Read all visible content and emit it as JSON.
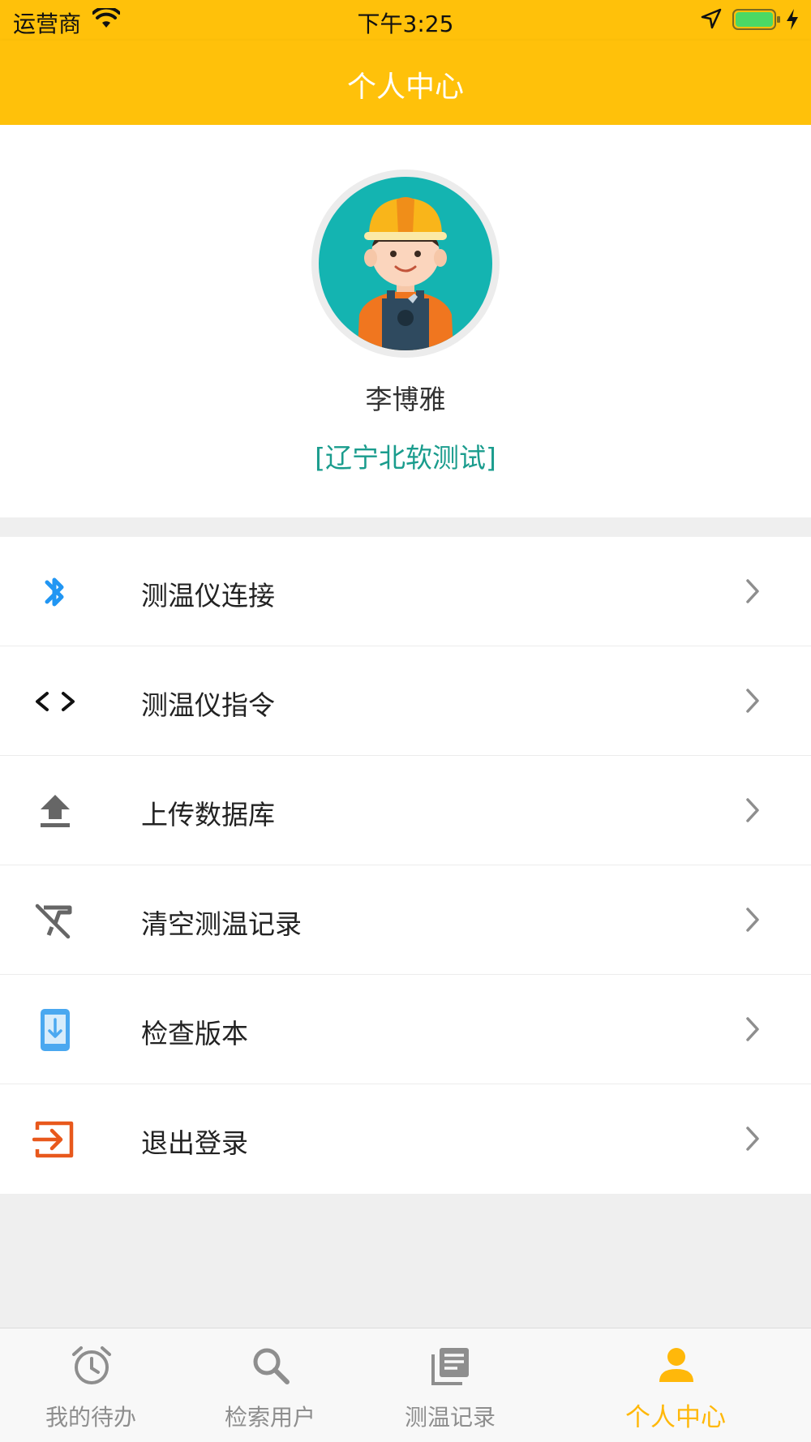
{
  "status_bar": {
    "carrier": "运营商",
    "time": "下午3:25"
  },
  "nav": {
    "title": "个人中心"
  },
  "profile": {
    "name": "李博雅",
    "org": "[辽宁北软测试]"
  },
  "menu": [
    {
      "label": "测温仪连接",
      "icon": "bluetooth-icon",
      "color": "#2196f3"
    },
    {
      "label": "测温仪指令",
      "icon": "code-icon",
      "color": "#111111"
    },
    {
      "label": "上传数据库",
      "icon": "upload-icon",
      "color": "#666666"
    },
    {
      "label": "清空测温记录",
      "icon": "clear-format-icon",
      "color": "#666666"
    },
    {
      "label": "检查版本",
      "icon": "phone-download-icon",
      "color": "#4aa8f0"
    },
    {
      "label": "退出登录",
      "icon": "logout-icon",
      "color": "#e8581c"
    }
  ],
  "tabs": [
    {
      "label": "我的待办",
      "icon": "alarm-clock-icon",
      "active": false
    },
    {
      "label": "检索用户",
      "icon": "search-icon",
      "active": false
    },
    {
      "label": "测温记录",
      "icon": "records-icon",
      "active": false
    },
    {
      "label": "个人中心",
      "icon": "person-icon",
      "active": true
    }
  ],
  "colors": {
    "primary": "#ffc10a",
    "accent_text": "#1a9c8d",
    "active_tab": "#ffb80a",
    "inactive_tab": "#8e8e8e"
  }
}
